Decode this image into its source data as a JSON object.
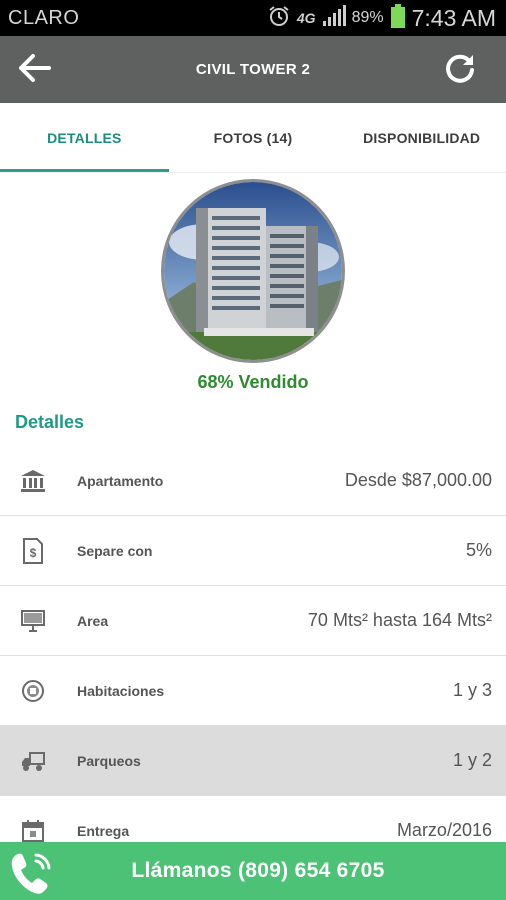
{
  "status_bar": {
    "carrier": "CLARO",
    "network": "4G",
    "battery": "89%",
    "time": "7:43 AM"
  },
  "app_bar": {
    "title": "CIVIL TOWER 2",
    "back_icon": "arrow-left-icon",
    "refresh_icon": "refresh-icon"
  },
  "tabs": [
    {
      "label": "DETALLES",
      "active": true
    },
    {
      "label": "FOTOS (14)",
      "active": false
    },
    {
      "label": "DISPONIBILIDAD",
      "active": false
    }
  ],
  "project": {
    "sold_text": "68% Vendido",
    "details_heading": "Detalles"
  },
  "details": [
    {
      "label": "Apartamento",
      "value": "Desde $87,000.00",
      "icon": "bank-icon"
    },
    {
      "label": "Separe con",
      "value": "5%",
      "icon": "money-document-icon"
    },
    {
      "label": "Area",
      "value": "70 Mts² hasta 164 Mts²",
      "icon": "monitor-icon"
    },
    {
      "label": "Habitaciones",
      "value": "1 y 3",
      "icon": "room-icon"
    },
    {
      "label": "Parqueos",
      "value": "1 y 2",
      "icon": "truck-icon"
    },
    {
      "label": "Entrega",
      "value": "Marzo/2016",
      "icon": "calendar-icon"
    }
  ],
  "call": {
    "label": "Llámanos (809) 654 6705",
    "icon": "phone-icon"
  },
  "colors": {
    "accent": "#1f9a86",
    "sold": "#2e8b2f",
    "appbar": "#5f6160",
    "callbar": "#4cc276"
  }
}
